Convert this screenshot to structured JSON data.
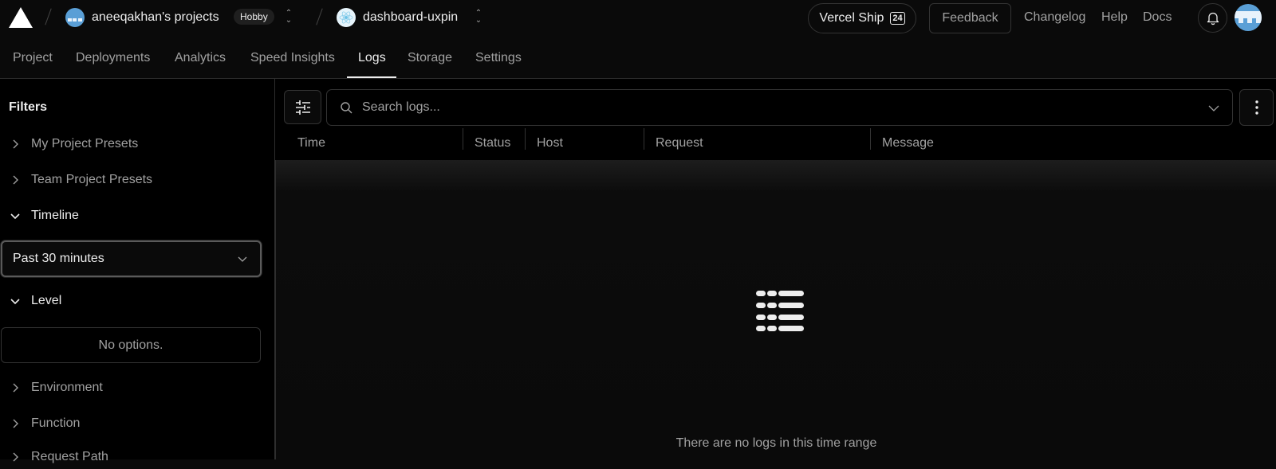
{
  "topbar": {
    "team_name": "aneeqakhan's projects",
    "plan_badge": "Hobby",
    "project_name": "dashboard-uxpin",
    "ship_label": "Vercel Ship",
    "ship_badge": "24",
    "feedback_label": "Feedback",
    "links": [
      "Changelog",
      "Help",
      "Docs"
    ]
  },
  "tabs": [
    {
      "label": "Project",
      "active": false
    },
    {
      "label": "Deployments",
      "active": false
    },
    {
      "label": "Analytics",
      "active": false
    },
    {
      "label": "Speed Insights",
      "active": false
    },
    {
      "label": "Logs",
      "active": true
    },
    {
      "label": "Storage",
      "active": false
    },
    {
      "label": "Settings",
      "active": false
    }
  ],
  "sidebar": {
    "title": "Filters",
    "sections": [
      {
        "label": "My Project Presets",
        "expanded": false
      },
      {
        "label": "Team Project Presets",
        "expanded": false
      },
      {
        "label": "Timeline",
        "expanded": true
      },
      {
        "label": "Level",
        "expanded": true
      },
      {
        "label": "Environment",
        "expanded": false
      },
      {
        "label": "Function",
        "expanded": false
      },
      {
        "label": "Request Path",
        "expanded": false
      }
    ],
    "timeline_value": "Past 30 minutes",
    "level_empty": "No options."
  },
  "main": {
    "search_placeholder": "Search logs...",
    "columns": [
      "Time",
      "Status",
      "Host",
      "Request",
      "Message"
    ],
    "empty_message": "There are no logs in this time range"
  },
  "icons": {
    "logo": "vercel-triangle",
    "filter": "sliders-icon",
    "search": "search-icon",
    "more": "more-vertical-icon",
    "bell": "bell-icon",
    "empty": "list-icon"
  }
}
